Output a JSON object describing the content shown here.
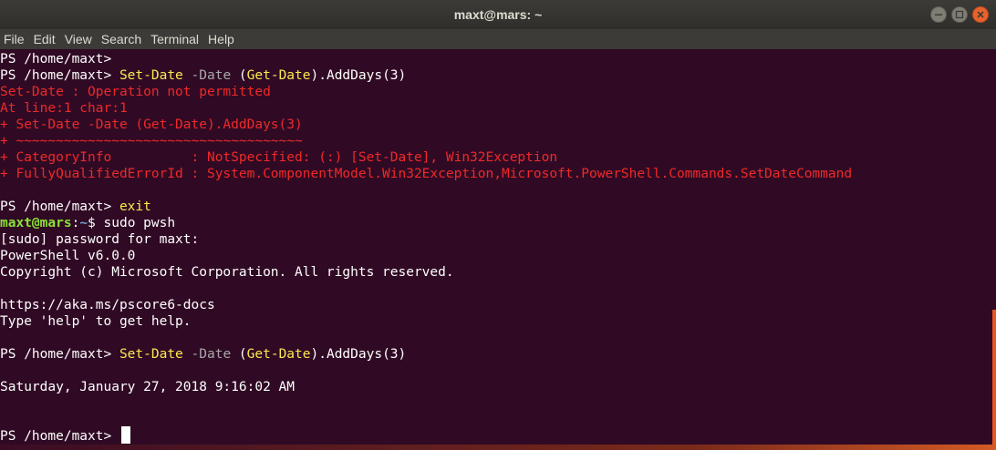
{
  "window": {
    "title": "maxt@mars: ~"
  },
  "menu": {
    "items": [
      "File",
      "Edit",
      "View",
      "Search",
      "Terminal",
      "Help"
    ]
  },
  "icons": {
    "minimize": "minimize-icon",
    "maximize": "maximize-icon",
    "close": "close-icon"
  },
  "colors": {
    "background": "#300a24",
    "command": "#fce94f",
    "parameter": "#a8a8a8",
    "error": "#ef2929",
    "user_host": "#8ae234",
    "path": "#729fcf",
    "accent": "#e95420"
  },
  "terminal": {
    "lines": [
      [
        {
          "t": "PS /home/maxt> ",
          "c": "white"
        }
      ],
      [
        {
          "t": "PS /home/maxt> ",
          "c": "white"
        },
        {
          "t": "Set-Date",
          "c": "yellow"
        },
        {
          "t": " ",
          "c": "white"
        },
        {
          "t": "-Date",
          "c": "gray"
        },
        {
          "t": " (",
          "c": "white"
        },
        {
          "t": "Get-Date",
          "c": "yellow"
        },
        {
          "t": ").AddDays(3)",
          "c": "white"
        }
      ],
      [
        {
          "t": "Set-Date : Operation not permitted",
          "c": "red"
        }
      ],
      [
        {
          "t": "At line:1 char:1",
          "c": "red"
        }
      ],
      [
        {
          "t": "+ Set-Date -Date (Get-Date).AddDays(3)",
          "c": "red"
        }
      ],
      [
        {
          "t": "+ ~~~~~~~~~~~~~~~~~~~~~~~~~~~~~~~~~~~~",
          "c": "red"
        }
      ],
      [
        {
          "t": "+ CategoryInfo          : NotSpecified: (:) [Set-Date], Win32Exception",
          "c": "red"
        }
      ],
      [
        {
          "t": "+ FullyQualifiedErrorId : System.ComponentModel.Win32Exception,Microsoft.PowerShell.Commands.SetDateCommand",
          "c": "red"
        }
      ],
      [],
      [
        {
          "t": "PS /home/maxt> ",
          "c": "white"
        },
        {
          "t": "exit",
          "c": "yellow"
        }
      ],
      [
        {
          "t": "maxt@mars",
          "c": "green"
        },
        {
          "t": ":",
          "c": "white"
        },
        {
          "t": "~",
          "c": "blue"
        },
        {
          "t": "$ sudo pwsh",
          "c": "white"
        }
      ],
      [
        {
          "t": "[sudo] password for maxt: ",
          "c": "white"
        }
      ],
      [
        {
          "t": "PowerShell v6.0.0",
          "c": "white"
        }
      ],
      [
        {
          "t": "Copyright (c) Microsoft Corporation. All rights reserved.",
          "c": "white"
        }
      ],
      [],
      [
        {
          "t": "https://aka.ms/pscore6-docs",
          "c": "white"
        }
      ],
      [
        {
          "t": "Type 'help' to get help.",
          "c": "white"
        }
      ],
      [],
      [
        {
          "t": "PS /home/maxt> ",
          "c": "white"
        },
        {
          "t": "Set-Date",
          "c": "yellow"
        },
        {
          "t": " ",
          "c": "white"
        },
        {
          "t": "-Date",
          "c": "gray"
        },
        {
          "t": " (",
          "c": "white"
        },
        {
          "t": "Get-Date",
          "c": "yellow"
        },
        {
          "t": ").AddDays(3)",
          "c": "white"
        }
      ],
      [],
      [
        {
          "t": "Saturday, January 27, 2018 9:16:02 AM",
          "c": "white"
        }
      ],
      [],
      [],
      [
        {
          "t": "PS /home/maxt> ",
          "c": "white"
        }
      ]
    ]
  }
}
